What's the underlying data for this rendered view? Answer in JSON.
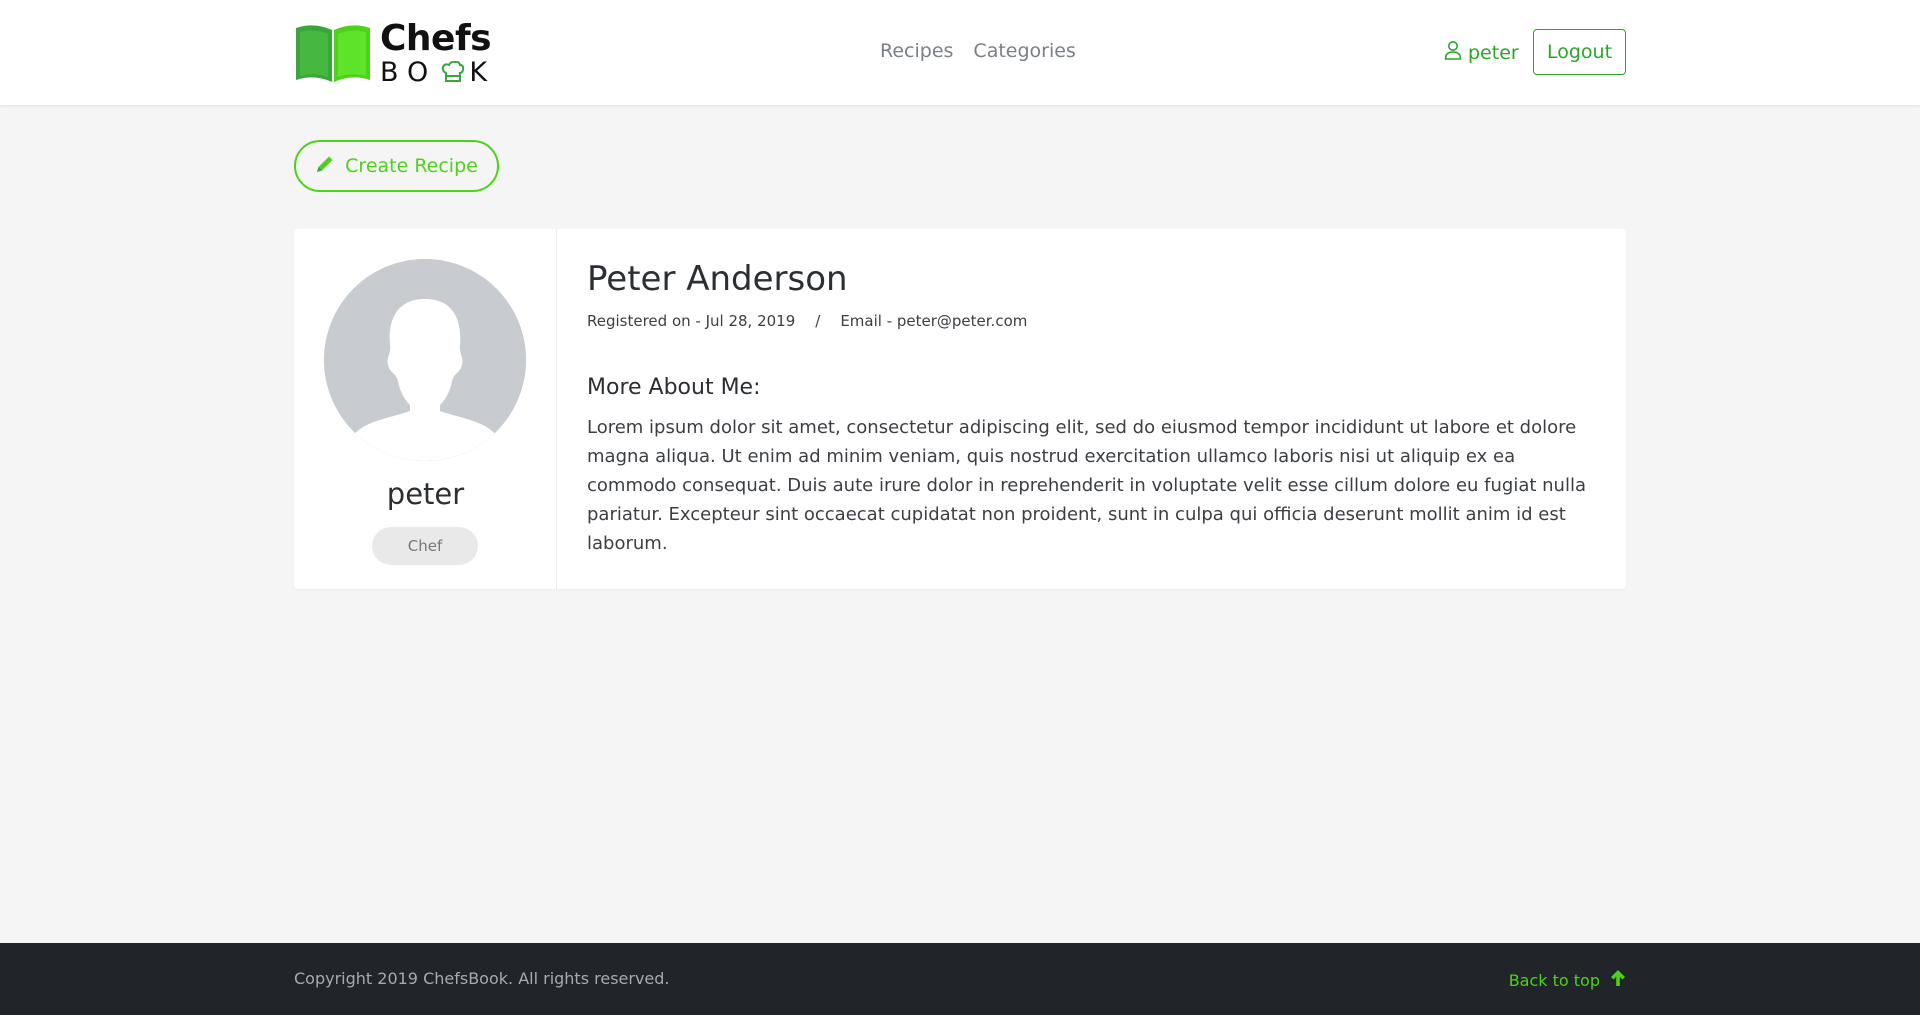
{
  "header": {
    "brand_top": "Chefs",
    "brand_bottom_left": "BO",
    "brand_bottom_right": "K",
    "nav": [
      {
        "label": "Recipes"
      },
      {
        "label": "Categories"
      }
    ],
    "user_label": "peter",
    "logout_label": "Logout"
  },
  "actions": {
    "create_recipe_label": "Create Recipe"
  },
  "profile": {
    "username": "peter",
    "role": "Chef",
    "full_name": "Peter Anderson",
    "registered": "Registered on - Jul 28, 2019",
    "separator": "/",
    "email": "Email - peter@peter.com",
    "about_title": "More About Me:",
    "about_text": "Lorem ipsum dolor sit amet, consectetur adipiscing elit, sed do eiusmod tempor incididunt ut labore et dolore magna aliqua. Ut enim ad minim veniam, quis nostrud exercitation ullamco laboris nisi ut aliquip ex ea commodo consequat. Duis aute irure dolor in reprehenderit in voluptate velit esse cillum dolore eu fugiat nulla pariatur. Excepteur sint occaecat cupidatat non proident, sunt in culpa qui officia deserunt mollit anim id est laborum."
  },
  "footer": {
    "copyright": "Copyright 2019 ChefsBook. All rights reserved.",
    "back_to_top": "Back to top"
  },
  "colors": {
    "accent_green": "#4ed11b",
    "link_green": "#2aa52a",
    "footer_bg": "#212529",
    "page_bg": "#f5f5f5"
  },
  "icons": {
    "logo": "book-logo-icon",
    "user": "user-icon",
    "create": "pencil-icon",
    "back_to_top": "arrow-up-icon"
  }
}
